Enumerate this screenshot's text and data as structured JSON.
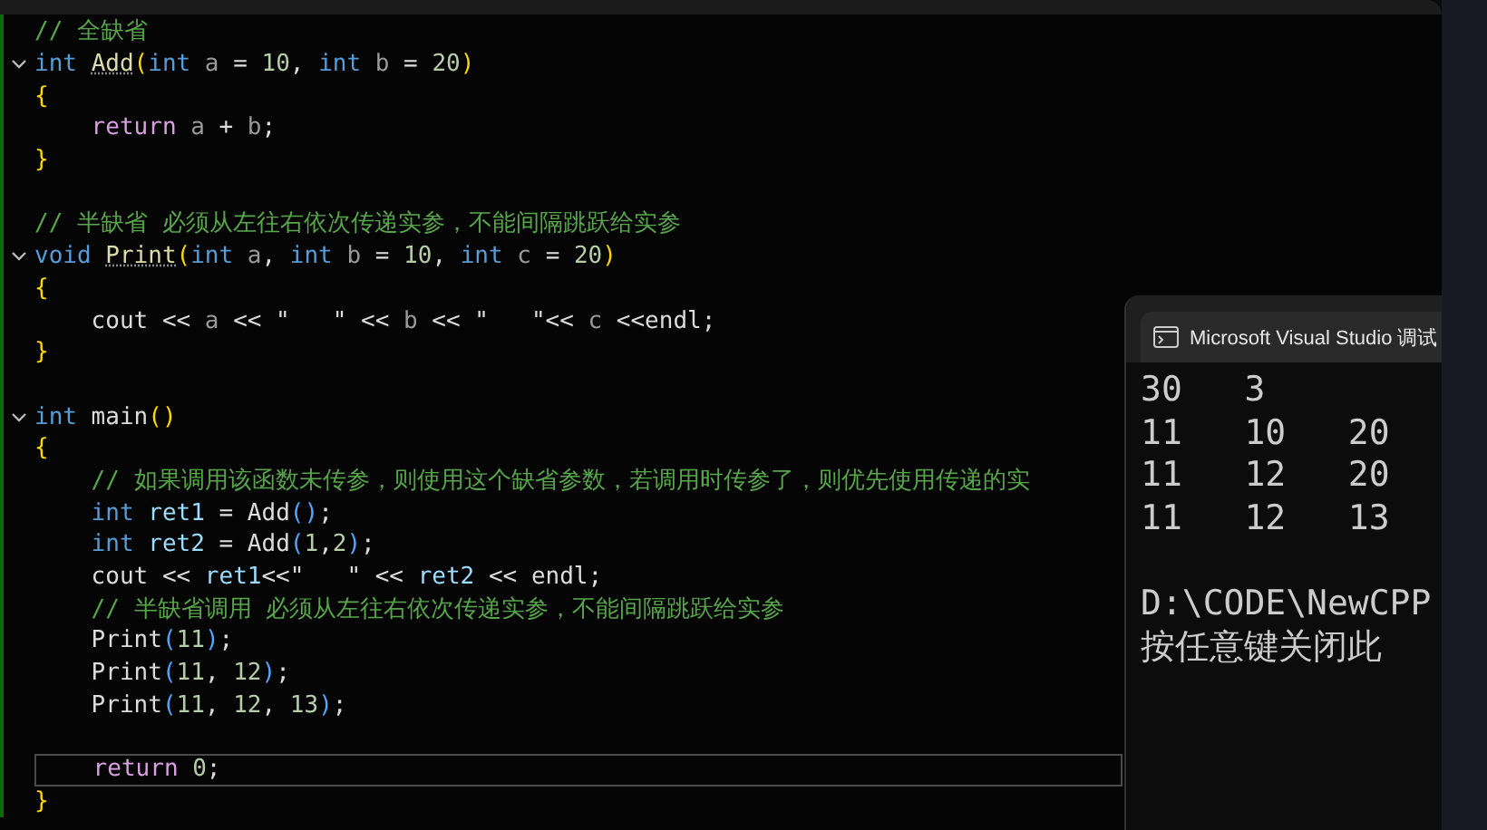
{
  "editor": {
    "lines": [
      {
        "tokens": [
          {
            "kind": "comment",
            "text": "// 全缺省"
          }
        ]
      },
      {
        "fold": true,
        "tokens": [
          {
            "kind": "keyword",
            "text": "int "
          },
          {
            "kind": "func",
            "text": "Add",
            "hint": true
          },
          {
            "kind": "paren1",
            "text": "("
          },
          {
            "kind": "keyword",
            "text": "int"
          },
          {
            "kind": "param",
            "text": " a "
          },
          {
            "kind": "plain",
            "text": "= "
          },
          {
            "kind": "number",
            "text": "10"
          },
          {
            "kind": "plain",
            "text": ", "
          },
          {
            "kind": "keyword",
            "text": "int"
          },
          {
            "kind": "param",
            "text": " b "
          },
          {
            "kind": "plain",
            "text": "= "
          },
          {
            "kind": "number",
            "text": "20"
          },
          {
            "kind": "paren1",
            "text": ")"
          }
        ]
      },
      {
        "tokens": [
          {
            "kind": "paren1",
            "text": "{"
          }
        ]
      },
      {
        "tokens": [
          {
            "kind": "control",
            "text": "    return"
          },
          {
            "kind": "param",
            "text": " a "
          },
          {
            "kind": "plain",
            "text": "+ "
          },
          {
            "kind": "param",
            "text": "b"
          },
          {
            "kind": "plain",
            "text": ";"
          }
        ]
      },
      {
        "tokens": [
          {
            "kind": "paren1",
            "text": "}"
          }
        ]
      },
      {
        "blank_before": true,
        "tokens": [
          {
            "kind": "comment",
            "text": "// 半缺省 必须从左往右依次传递实参，不能间隔跳跃给实参"
          }
        ]
      },
      {
        "fold": true,
        "tokens": [
          {
            "kind": "keyword",
            "text": "void "
          },
          {
            "kind": "func",
            "text": "Print",
            "hint": true
          },
          {
            "kind": "paren1",
            "text": "("
          },
          {
            "kind": "keyword",
            "text": "int"
          },
          {
            "kind": "param",
            "text": " a"
          },
          {
            "kind": "plain",
            "text": ", "
          },
          {
            "kind": "keyword",
            "text": "int"
          },
          {
            "kind": "param",
            "text": " b "
          },
          {
            "kind": "plain",
            "text": "= "
          },
          {
            "kind": "number",
            "text": "10"
          },
          {
            "kind": "plain",
            "text": ", "
          },
          {
            "kind": "keyword",
            "text": "int"
          },
          {
            "kind": "param",
            "text": " c "
          },
          {
            "kind": "plain",
            "text": "= "
          },
          {
            "kind": "number",
            "text": "20"
          },
          {
            "kind": "paren1",
            "text": ")"
          }
        ]
      },
      {
        "tokens": [
          {
            "kind": "paren1",
            "text": "{"
          }
        ]
      },
      {
        "tokens": [
          {
            "kind": "plain",
            "text": "    cout << "
          },
          {
            "kind": "param",
            "text": "a"
          },
          {
            "kind": "plain",
            "text": " << \"   \" << "
          },
          {
            "kind": "param",
            "text": "b"
          },
          {
            "kind": "plain",
            "text": " << \"   \"<< "
          },
          {
            "kind": "param",
            "text": "c"
          },
          {
            "kind": "plain",
            "text": " <<endl;"
          }
        ]
      },
      {
        "tokens": [
          {
            "kind": "paren1",
            "text": "}"
          }
        ]
      },
      {
        "blank_before": true,
        "fold": true,
        "tokens": [
          {
            "kind": "keyword",
            "text": "int"
          },
          {
            "kind": "plain",
            "text": " main"
          },
          {
            "kind": "paren1",
            "text": "()"
          }
        ]
      },
      {
        "tokens": [
          {
            "kind": "paren1",
            "text": "{"
          }
        ]
      },
      {
        "tokens": [
          {
            "kind": "comment",
            "text": "    // 如果调用该函数未传参，则使用这个缺省参数，若调用时传参了，则优先使用传递的实"
          }
        ]
      },
      {
        "tokens": [
          {
            "kind": "keyword",
            "text": "    int"
          },
          {
            "kind": "local",
            "text": " ret1"
          },
          {
            "kind": "plain",
            "text": " = Add"
          },
          {
            "kind": "paren2",
            "text": "()"
          },
          {
            "kind": "plain",
            "text": ";"
          }
        ]
      },
      {
        "tokens": [
          {
            "kind": "keyword",
            "text": "    int"
          },
          {
            "kind": "local",
            "text": " ret2"
          },
          {
            "kind": "plain",
            "text": " = Add"
          },
          {
            "kind": "paren2",
            "text": "("
          },
          {
            "kind": "number",
            "text": "1"
          },
          {
            "kind": "plain",
            "text": ","
          },
          {
            "kind": "number",
            "text": "2"
          },
          {
            "kind": "paren2",
            "text": ")"
          },
          {
            "kind": "plain",
            "text": ";"
          }
        ]
      },
      {
        "tokens": [
          {
            "kind": "plain",
            "text": "    cout << "
          },
          {
            "kind": "local",
            "text": "ret1"
          },
          {
            "kind": "plain",
            "text": "<<\"   \" << "
          },
          {
            "kind": "local",
            "text": "ret2"
          },
          {
            "kind": "plain",
            "text": " << endl;"
          }
        ]
      },
      {
        "tokens": [
          {
            "kind": "comment",
            "text": "    // 半缺省调用 必须从左往右依次传递实参，不能间隔跳跃给实参"
          }
        ]
      },
      {
        "tokens": [
          {
            "kind": "plain",
            "text": "    Print"
          },
          {
            "kind": "paren2",
            "text": "("
          },
          {
            "kind": "number",
            "text": "11"
          },
          {
            "kind": "paren2",
            "text": ")"
          },
          {
            "kind": "plain",
            "text": ";"
          }
        ]
      },
      {
        "tokens": [
          {
            "kind": "plain",
            "text": "    Print"
          },
          {
            "kind": "paren2",
            "text": "("
          },
          {
            "kind": "number",
            "text": "11"
          },
          {
            "kind": "plain",
            "text": ", "
          },
          {
            "kind": "number",
            "text": "12"
          },
          {
            "kind": "paren2",
            "text": ")"
          },
          {
            "kind": "plain",
            "text": ";"
          }
        ]
      },
      {
        "tokens": [
          {
            "kind": "plain",
            "text": "    Print"
          },
          {
            "kind": "paren2",
            "text": "("
          },
          {
            "kind": "number",
            "text": "11"
          },
          {
            "kind": "plain",
            "text": ", "
          },
          {
            "kind": "number",
            "text": "12"
          },
          {
            "kind": "plain",
            "text": ", "
          },
          {
            "kind": "number",
            "text": "13"
          },
          {
            "kind": "paren2",
            "text": ")"
          },
          {
            "kind": "plain",
            "text": ";"
          }
        ]
      },
      {
        "blank_before": true,
        "current": true,
        "tokens": [
          {
            "kind": "control",
            "text": "    return "
          },
          {
            "kind": "number",
            "text": "0"
          },
          {
            "kind": "plain",
            "text": ";"
          }
        ]
      },
      {
        "tokens": [
          {
            "kind": "paren1",
            "text": "}"
          }
        ]
      }
    ]
  },
  "console": {
    "title": "Microsoft Visual Studio 调试",
    "output": [
      "30   3",
      "11   10   20",
      "11   12   20",
      "11   12   13"
    ],
    "prompt": [
      "D:\\CODE\\NewCPP",
      "按任意键关闭此"
    ]
  }
}
